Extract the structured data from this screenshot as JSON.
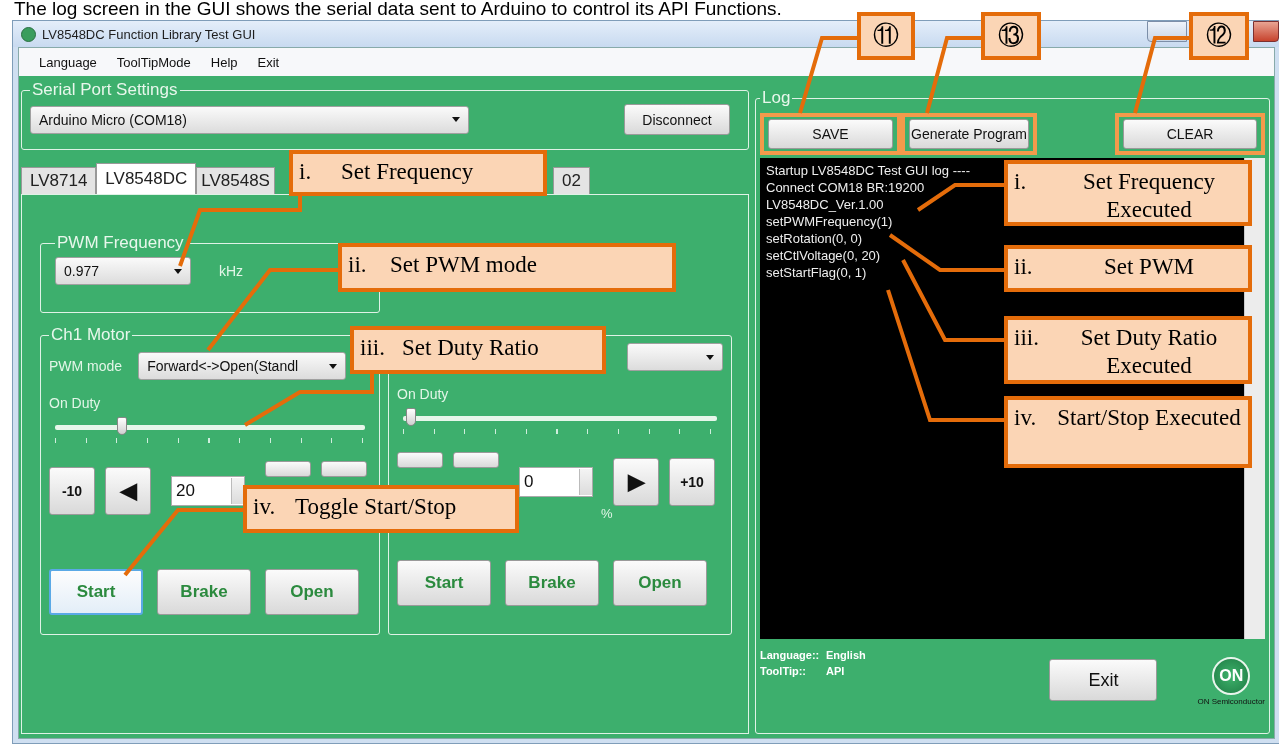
{
  "caption": "The log screen in the GUI shows the serial data sent to Arduino to control its API Functions.",
  "window": {
    "title": "LV8548DC Function Library Test GUI"
  },
  "menu": [
    "Language",
    "ToolTipMode",
    "Help",
    "Exit"
  ],
  "serial_port": {
    "title": "Serial Port Settings",
    "port": "Arduino Micro (COM18)",
    "button": "Disconnect"
  },
  "tabs": [
    {
      "label": "LV8714",
      "selected": false
    },
    {
      "label": "LV8548DC",
      "selected": true
    },
    {
      "label": "LV8548S",
      "selected": false
    },
    {
      "label": "02",
      "selected": false
    }
  ],
  "pwm_frequency": {
    "title": "PWM Frequency",
    "value": "0.977",
    "unit": "kHz"
  },
  "channels": [
    {
      "title": "Ch1 Motor",
      "mode_label": "PWM mode",
      "mode": "Forward<->Open(Standl",
      "duty_label": "On Duty",
      "level": 0.2,
      "steps": [
        {
          "label": "-10",
          "kind": "text"
        },
        {
          "label": "◀",
          "kind": "glyph"
        },
        {
          "kind": "hidden"
        },
        {
          "kind": "hidden"
        }
      ],
      "value": "20",
      "actions": [
        {
          "label": "Start",
          "focused": true
        },
        {
          "label": "Brake",
          "focused": false
        },
        {
          "label": "Open",
          "focused": false
        }
      ]
    },
    {
      "duty_label": "On Duty",
      "level": 0,
      "steps": [
        {
          "kind": "hidden"
        },
        {
          "kind": "hidden"
        },
        {
          "label": "▶",
          "kind": "glyph"
        },
        {
          "label": "+10",
          "kind": "text"
        }
      ],
      "value": "0",
      "unit": "%",
      "actions": [
        {
          "label": "Start",
          "focused": false
        },
        {
          "label": "Brake",
          "focused": false
        },
        {
          "label": "Open",
          "focused": false
        }
      ]
    }
  ],
  "log": {
    "title": "Log",
    "buttons": [
      "SAVE",
      "Generate Program",
      "CLEAR"
    ],
    "lines": [
      "Startup LV8548DC Test GUI log ----",
      "Connect COM18  BR:19200",
      "LV8548DC_Ver.1.00",
      "setPWMFrequency(1)",
      "setRotation(0, 0)",
      "setCtlVoltage(0, 20)",
      "setStartFlag(0, 1)"
    ]
  },
  "status": [
    {
      "label": "Language::",
      "value": "English"
    },
    {
      "label": "ToolTip::",
      "value": "API"
    }
  ],
  "exit_button": "Exit",
  "logo": {
    "mark": "ON",
    "caption": "ON Semiconductor"
  },
  "callouts": [
    {
      "kind": "number",
      "text": "⑪"
    },
    {
      "kind": "number",
      "text": "⑬"
    },
    {
      "kind": "number",
      "text": "⑫"
    },
    {
      "kind": "note",
      "marker": "i.",
      "text": "Set Frequency"
    },
    {
      "kind": "note",
      "marker": "i.",
      "text": "Set Frequency Executed"
    },
    {
      "kind": "note",
      "marker": "ii.",
      "text": "Set PWM mode"
    },
    {
      "kind": "note",
      "marker": "ii.",
      "text": "Set PWM"
    },
    {
      "kind": "note",
      "marker": "iii.",
      "text": "Set Duty Ratio"
    },
    {
      "kind": "note",
      "marker": "iii.",
      "text": "Set Duty Ratio Executed"
    },
    {
      "kind": "note",
      "marker": "iv.",
      "text": "Start/Stop Executed"
    },
    {
      "kind": "note",
      "marker": "iv.",
      "text": "Toggle Start/Stop"
    }
  ]
}
